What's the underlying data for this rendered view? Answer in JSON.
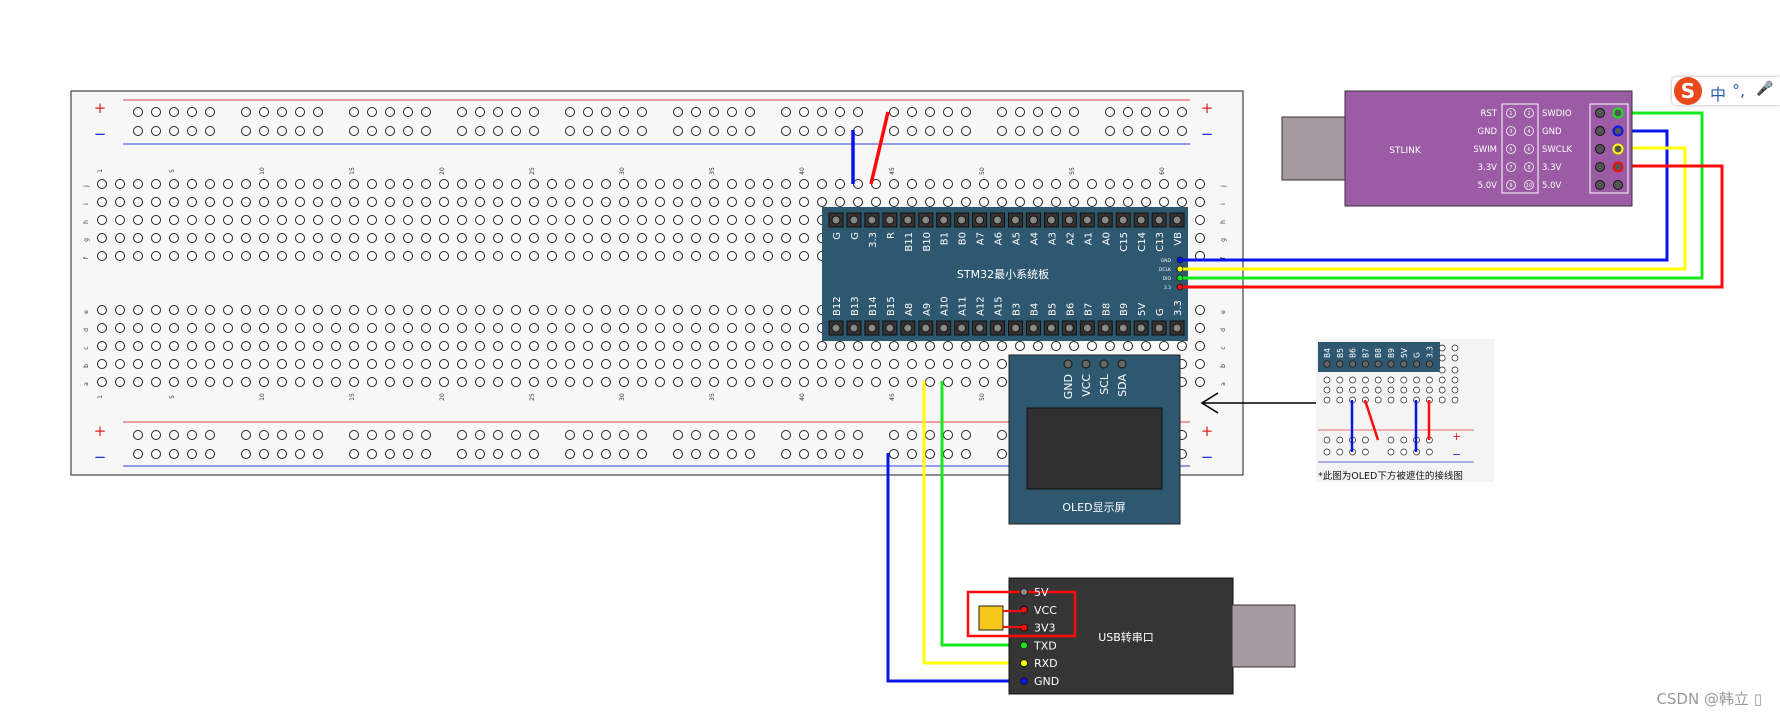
{
  "breadboard": {
    "plus": "+",
    "minus": "−",
    "col_numbers": [
      "1",
      "5",
      "10",
      "15",
      "20",
      "25",
      "30",
      "35",
      "40",
      "45",
      "50",
      "55",
      "60"
    ],
    "rows_top": [
      "j",
      "i",
      "h",
      "g",
      "f"
    ],
    "rows_bottom": [
      "e",
      "d",
      "c",
      "b",
      "a"
    ]
  },
  "stm32": {
    "title": "STM32最小系统板",
    "pins_top": [
      "G",
      "G",
      "3.3",
      "R",
      "B11",
      "B10",
      "B1",
      "B0",
      "A7",
      "A6",
      "A5",
      "A4",
      "A3",
      "A2",
      "A1",
      "A0",
      "C15",
      "C14",
      "C13",
      "VB"
    ],
    "pins_bottom": [
      "B12",
      "B13",
      "B14",
      "B15",
      "A8",
      "A9",
      "A10",
      "A11",
      "A12",
      "A15",
      "B3",
      "B4",
      "B5",
      "B6",
      "B7",
      "B8",
      "B9",
      "5V",
      "G",
      "3.3"
    ],
    "swd_pins": [
      "GND",
      "DCLK",
      "DIO",
      "3.3"
    ]
  },
  "stlink": {
    "title": "STLINK",
    "left_labels": [
      "RST",
      "GND",
      "SWIM",
      "3.3V",
      "5.0V"
    ],
    "right_labels": [
      "SWDIO",
      "GND",
      "SWCLK",
      "3.3V",
      "5.0V"
    ],
    "pin_numbers_left": [
      "1",
      "3",
      "5",
      "7",
      "9"
    ],
    "pin_numbers_right": [
      "2",
      "4",
      "6",
      "8",
      "10"
    ]
  },
  "oled": {
    "title": "OLED显示屏",
    "pins": [
      "GND",
      "VCC",
      "SCL",
      "SDA"
    ]
  },
  "usb_serial": {
    "title": "USB转串口",
    "pins": [
      "5V",
      "VCC",
      "3V3",
      "TXD",
      "RXD",
      "GND"
    ]
  },
  "inset": {
    "caption": "*此图为OLED下方被遮住的接线图",
    "pins": [
      "B4",
      "B5",
      "B6",
      "B7",
      "B8",
      "B9",
      "5V",
      "G",
      "3.3"
    ],
    "plus": "+",
    "minus": "−"
  },
  "ime_toolbar": {
    "logo": "S",
    "lang": "中",
    "punct": "°,",
    "mic": "🎤"
  },
  "watermark": "CSDN @韩立  ▯",
  "colors": {
    "stm32_board": "#2e5870",
    "oled_board": "#2e5870",
    "stlink_board": "#9b5ba5",
    "usb_board": "#353535",
    "usb_plug": "#a59aa0",
    "wire_blue": "#0a14e6",
    "wire_red": "#ff0a0a",
    "wire_yellow": "#ffff00",
    "wire_green": "#17e81e",
    "rail_red": "#e04040",
    "rail_blue": "#2f3fe0"
  }
}
